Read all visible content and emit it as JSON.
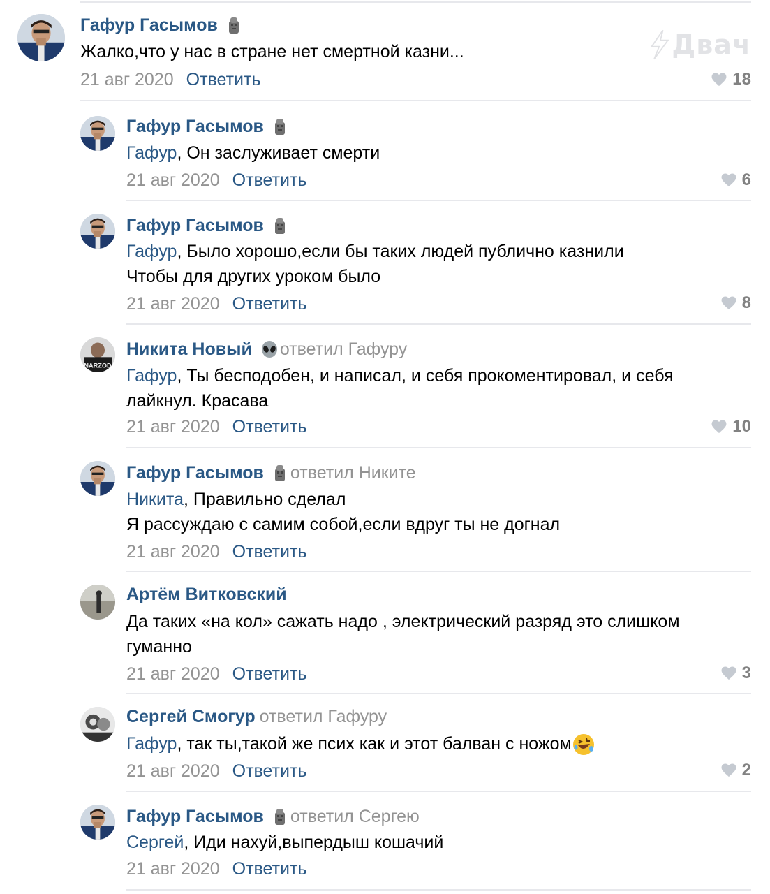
{
  "watermark": "Двач",
  "colors": {
    "link": "#2a5885",
    "muted": "#939393",
    "separator": "#e7e8ec"
  },
  "comments": [
    {
      "author": "Гафур Гасымов",
      "badge": "statue-icon",
      "replied_to": "",
      "mention": "",
      "text": "Жалко,что у нас в стране нет смертной казни...",
      "date": "21 авг 2020",
      "reply_label": "Ответить",
      "likes": "18"
    },
    {
      "author": "Гафур Гасымов",
      "badge": "statue-icon",
      "replied_to": "",
      "mention": "Гафур",
      "text": ", Он заслуживает смерти",
      "date": "21 авг 2020",
      "reply_label": "Ответить",
      "likes": "6"
    },
    {
      "author": "Гафур Гасымов",
      "badge": "statue-icon",
      "replied_to": "",
      "mention": "Гафур",
      "text": ", Было хорошо,если бы таких людей публично казнили",
      "text2": "Чтобы для других уроком было",
      "date": "21 авг 2020",
      "reply_label": "Ответить",
      "likes": "8"
    },
    {
      "author": "Никита Новый",
      "badge": "alien-icon",
      "replied_to": "ответил Гафуру",
      "mention": "Гафур",
      "text": ", Ты бесподобен, и написал, и себя прокоментировал, и себя",
      "text2": "лайкнул. Красава",
      "date": "21 авг 2020",
      "reply_label": "Ответить",
      "likes": "10"
    },
    {
      "author": "Гафур Гасымов",
      "badge": "statue-icon",
      "replied_to": "ответил Никите",
      "mention": "Никита",
      "text": ", Правильно сделал",
      "text2": "Я рассуждаю с самим собой,если вдруг ты не догнал",
      "date": "21 авг 2020",
      "reply_label": "Ответить",
      "likes": ""
    },
    {
      "author": "Артём Витковский",
      "badge": "",
      "replied_to": "",
      "mention": "",
      "text": "Да таких «на кол» сажать надо , электрический разряд это слишком",
      "text2": "гуманно",
      "date": "21 авг 2020",
      "reply_label": "Ответить",
      "likes": "3"
    },
    {
      "author": "Сергей Смогур",
      "badge": "",
      "replied_to": "ответил Гафуру",
      "mention": "Гафур",
      "text": ", так ты,такой же псих как и этот балван с ножом",
      "date": "21 авг 2020",
      "reply_label": "Ответить",
      "likes": "2"
    },
    {
      "author": "Гафур Гасымов",
      "badge": "statue-icon",
      "replied_to": "ответил Сергею",
      "mention": "Сергей",
      "text": ", Иди нахуй,выпердыш кошачий",
      "date": "21 авг 2020",
      "reply_label": "Ответить",
      "likes": ""
    }
  ]
}
